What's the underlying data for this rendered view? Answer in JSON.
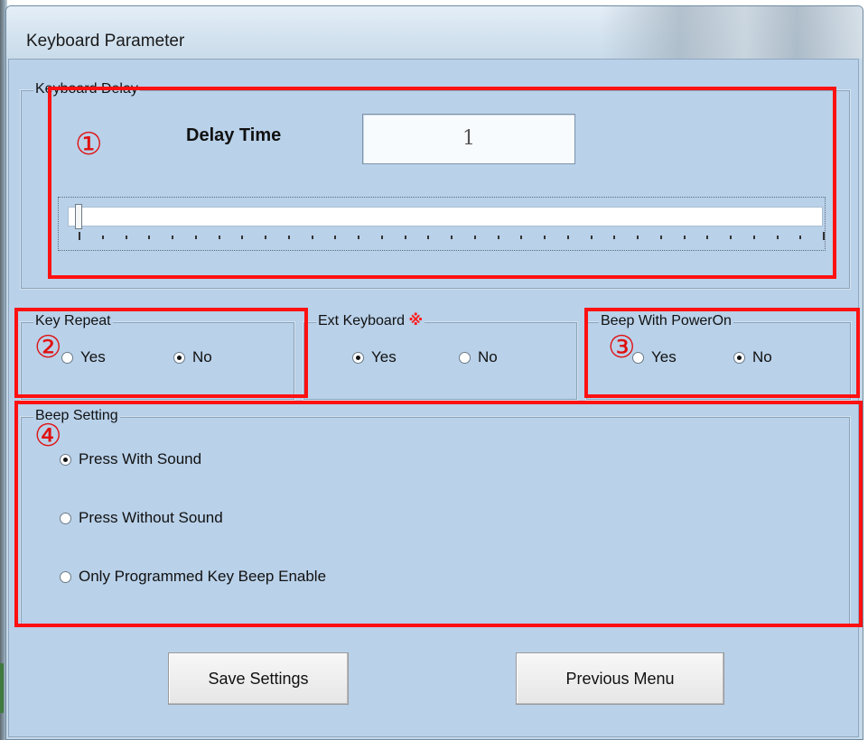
{
  "window": {
    "title": "Keyboard Parameter"
  },
  "keyboard_delay": {
    "legend": "Keyboard Delay",
    "delay_label": "Delay Time",
    "delay_value": "1",
    "slider_level_fraction": 0.0
  },
  "key_repeat": {
    "legend": "Key Repeat",
    "options": [
      "Yes",
      "No"
    ],
    "selected": "No"
  },
  "ext_keyboard": {
    "legend": "Ext Keyboard",
    "mark": "※",
    "options": [
      "Yes",
      "No"
    ],
    "selected": "Yes"
  },
  "beep_power_on": {
    "legend": "Beep With PowerOn",
    "options": [
      "Yes",
      "No"
    ],
    "selected": "No"
  },
  "beep_setting": {
    "legend": "Beep Setting",
    "options": [
      "Press With Sound",
      "Press Without Sound",
      "Only Programmed Key Beep Enable"
    ],
    "selected": "Press With Sound"
  },
  "buttons": {
    "save": "Save Settings",
    "previous": "Previous Menu"
  },
  "annotations": {
    "n1": "①",
    "n2": "②",
    "n3": "③",
    "n4": "④"
  },
  "colors": {
    "annotation_red": "#ff1111",
    "client_bg": "#b9d1e9"
  }
}
